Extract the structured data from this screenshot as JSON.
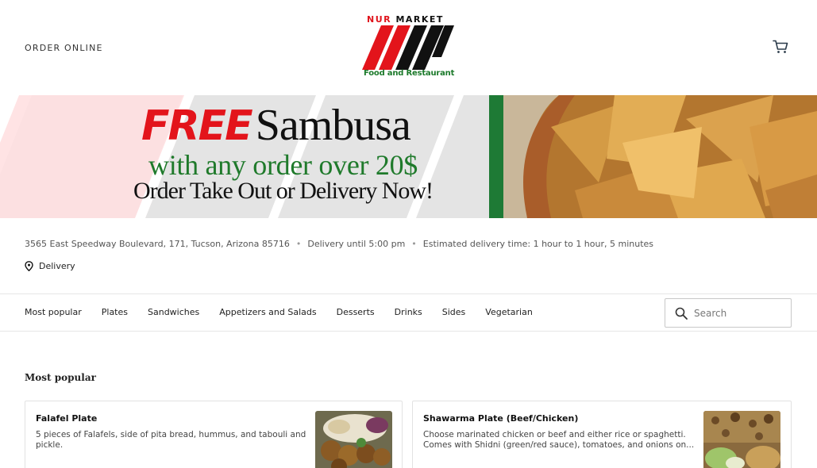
{
  "header": {
    "order_online": "ORDER ONLINE",
    "logo": {
      "top_left": "NUR",
      "top_right": "MARKET",
      "bottom": "Food and Restaurant"
    },
    "cart_icon": "cart-icon"
  },
  "banner": {
    "free": "FREE",
    "sambusa": "Sambusa",
    "line2": "with any order over 20$",
    "line3": "Order Take Out or Delivery Now!"
  },
  "info": {
    "address": "3565 East Speedway Boulevard, 171, Tucson, Arizona 85716",
    "delivery_until": "Delivery until 5:00 pm",
    "estimated": "Estimated delivery time: 1 hour to 1 hour, 5 minutes",
    "mode": "Delivery"
  },
  "nav": {
    "items": [
      "Most popular",
      "Plates",
      "Sandwiches",
      "Appetizers and Salads",
      "Desserts",
      "Drinks",
      "Sides",
      "Vegetarian"
    ],
    "search_placeholder": "Search"
  },
  "section": {
    "title": "Most popular",
    "cards": [
      {
        "title": "Falafel Plate",
        "desc": "5 pieces of Falafels, side of pita bread, hummus, and tabouli and pickle."
      },
      {
        "title": "Shawarma Plate (Beef/Chicken)",
        "desc": "Choose marinated chicken or beef and either rice or spaghetti. Comes with Shidni (green/red sauce), tomatoes, and onions on..."
      }
    ]
  },
  "colors": {
    "brand_red": "#e3141b",
    "brand_green": "#1e7a35",
    "text": "#222222"
  }
}
